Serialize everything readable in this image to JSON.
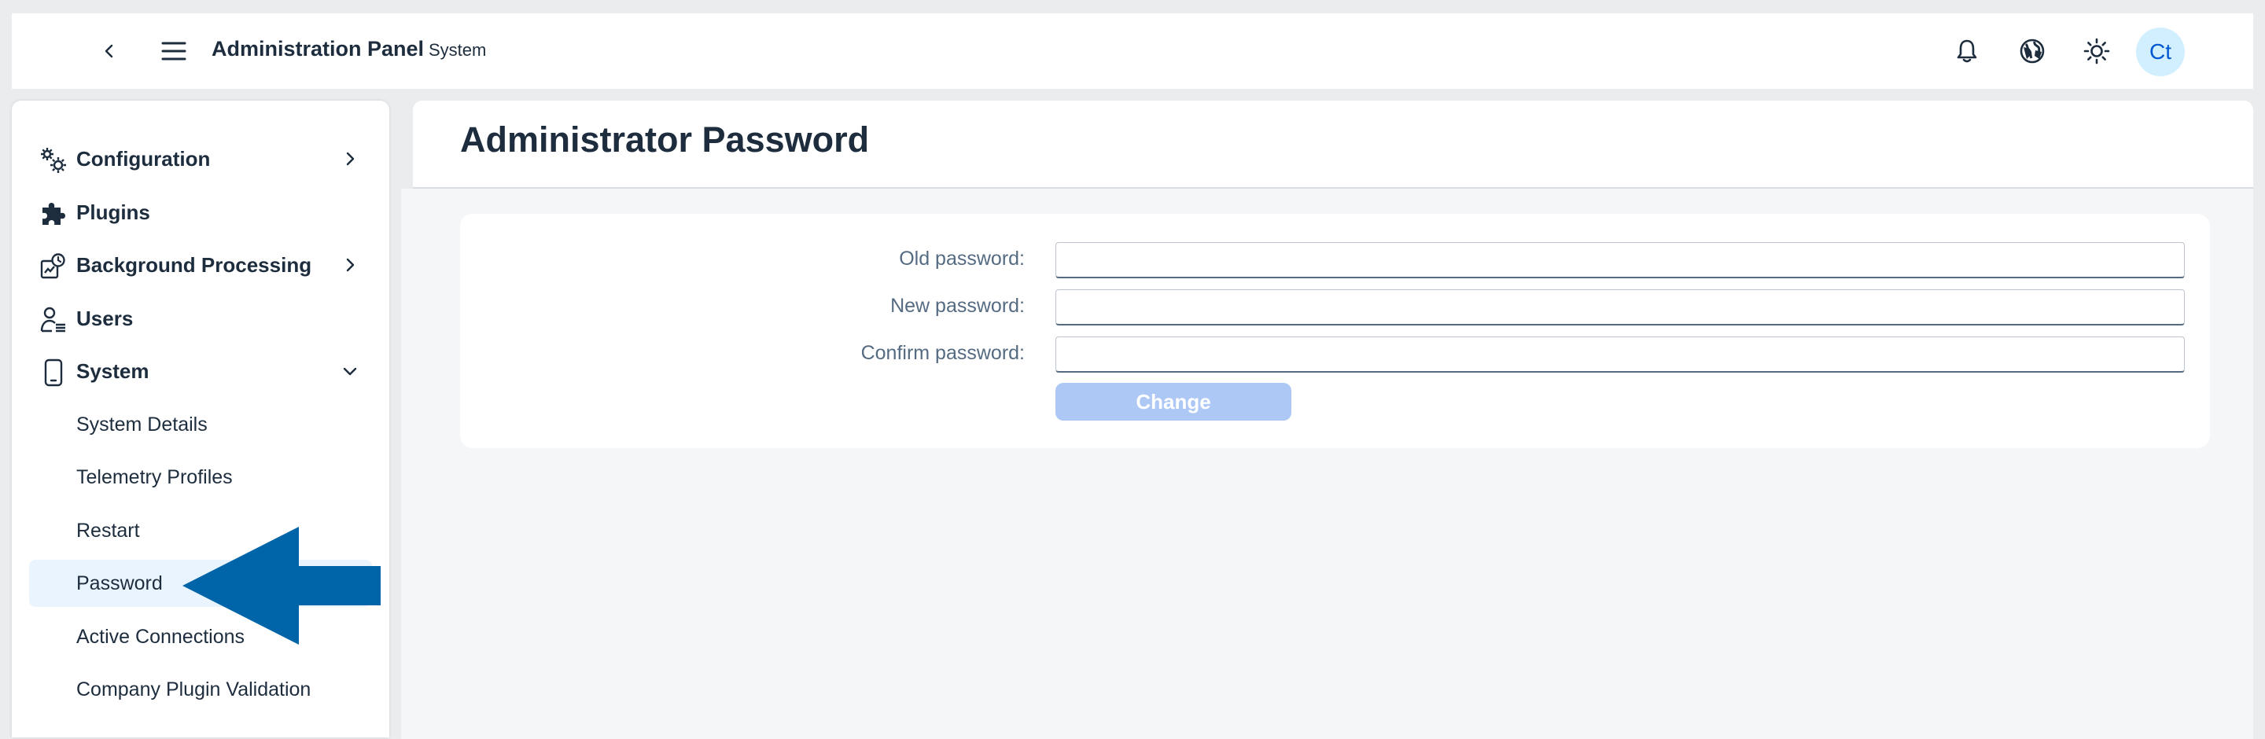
{
  "header": {
    "title": "Administration Panel",
    "subtitle": "System",
    "avatar_initials": "Ct",
    "icons": [
      "back-icon",
      "menu-icon",
      "bell-icon",
      "globe-icon",
      "sun-icon"
    ]
  },
  "sidebar": {
    "items": [
      {
        "label": "Configuration",
        "icon": "gears-icon",
        "chevron": "right"
      },
      {
        "label": "Plugins",
        "icon": "puzzle-icon",
        "chevron": ""
      },
      {
        "label": "Background Processing",
        "icon": "background-processing-icon",
        "chevron": "right"
      },
      {
        "label": "Users",
        "icon": "users-icon",
        "chevron": ""
      },
      {
        "label": "System",
        "icon": "device-icon",
        "chevron": "down"
      }
    ],
    "subitems": [
      {
        "label": "System Details"
      },
      {
        "label": "Telemetry Profiles"
      },
      {
        "label": "Restart"
      },
      {
        "label": "Password",
        "selected": true
      },
      {
        "label": "Active Connections"
      },
      {
        "label": "Company Plugin Validation"
      }
    ]
  },
  "page": {
    "title": "Administrator Password"
  },
  "form": {
    "old_password_label": "Old password:",
    "new_password_label": "New password:",
    "confirm_password_label": "Confirm password:",
    "old_password_value": "",
    "new_password_value": "",
    "confirm_password_value": "",
    "change_label": "Change"
  },
  "colors": {
    "accent": "#0064d9",
    "arrow": "#0064a8",
    "button_disabled": "#aec8f6",
    "selected_bg": "#eaf4fe"
  }
}
